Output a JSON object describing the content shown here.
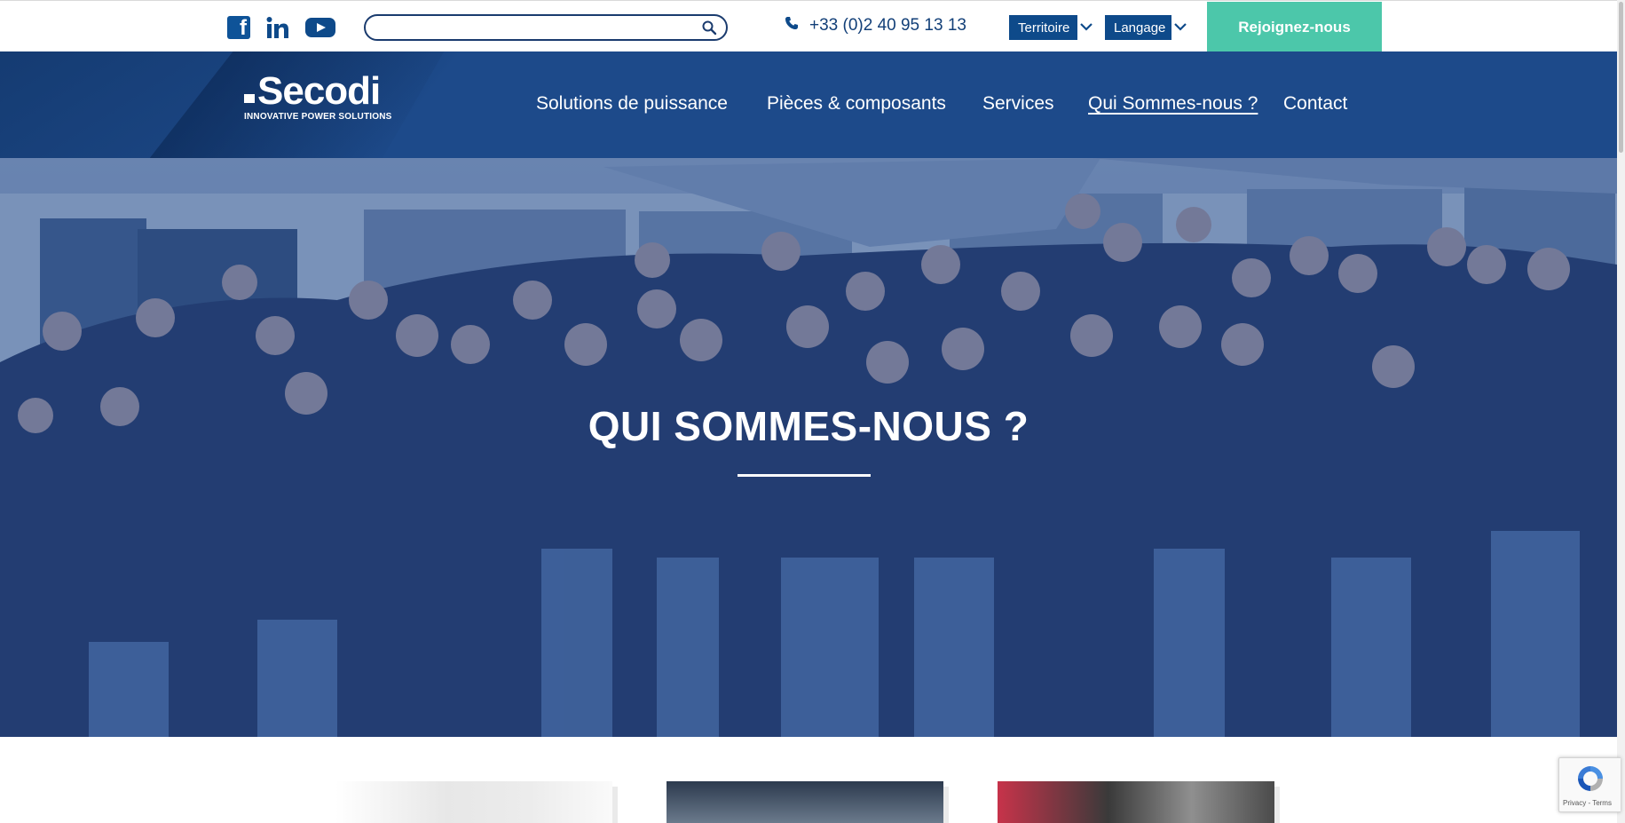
{
  "topbar": {
    "search": {
      "placeholder": "",
      "value": ""
    },
    "phone": "+33 (0)2 40 95 13 13",
    "territoire_label": "Territoire",
    "langage_label": "Langage",
    "join_label": "Rejoignez-nous"
  },
  "nav": {
    "logo_word": "Secodi",
    "logo_tagline": "INNOVATIVE POWER SOLUTIONS",
    "items": [
      {
        "label": "Solutions de puissance"
      },
      {
        "label": "Pièces & composants"
      },
      {
        "label": "Services"
      },
      {
        "label": "Qui Sommes-nous ?",
        "active": true
      },
      {
        "label": "Contact"
      }
    ]
  },
  "hero": {
    "title": "QUI SOMMES-NOUS ?"
  },
  "recaptcha": {
    "text": "Privacy - Terms"
  },
  "colors": {
    "brand_blue": "#1d4a8a",
    "accent_green": "#4cc7aa",
    "hero_overlay": "#2c4f8c"
  },
  "icons": [
    "facebook-icon",
    "linkedin-icon",
    "youtube-icon",
    "search-icon",
    "phone-icon",
    "chevron-down-icon",
    "recaptcha-icon"
  ]
}
